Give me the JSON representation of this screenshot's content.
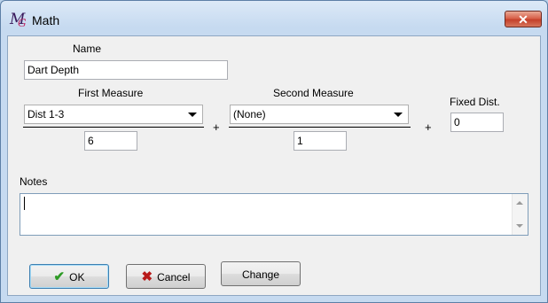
{
  "window": {
    "title": "Math",
    "close_glyph": "✕"
  },
  "app_icon": {
    "glyph_main": "M",
    "glyph_sub": "G"
  },
  "name": {
    "label": "Name",
    "value": "Dart Depth"
  },
  "first_measure": {
    "label": "First Measure",
    "selected": "Dist 1-3",
    "divisor": "6"
  },
  "plus_1": "+",
  "second_measure": {
    "label": "Second Measure",
    "selected": "(None)",
    "divisor": "1"
  },
  "plus_2": "+",
  "fixed_dist": {
    "label": "Fixed Dist.",
    "value": "0"
  },
  "notes": {
    "label": "Notes",
    "value": ""
  },
  "buttons": {
    "ok": {
      "label": "OK",
      "icon": "checkmark-icon",
      "glyph": "✔"
    },
    "cancel": {
      "label": "Cancel",
      "icon": "x-icon",
      "glyph": "✖"
    },
    "change": {
      "label": "Change"
    }
  },
  "colors": {
    "titlebar": "#c6daf0",
    "close_button": "#c4402a",
    "ok_check": "#2e9b26",
    "cancel_x": "#b81a1a"
  }
}
